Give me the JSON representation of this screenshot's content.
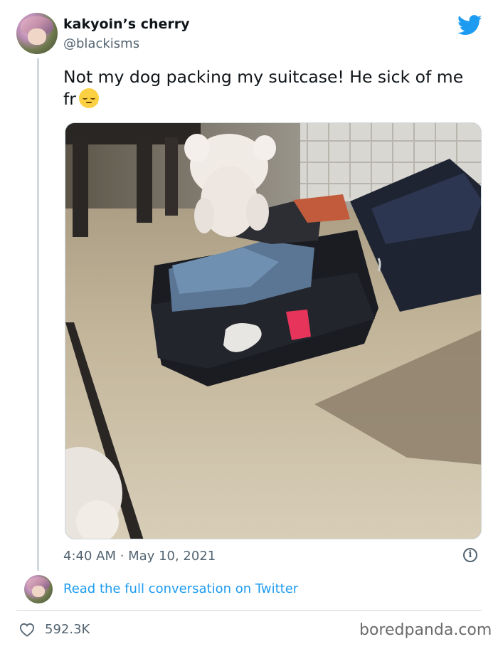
{
  "tweet": {
    "display_name": "kakyoin’s cherry",
    "handle": "@blackisms",
    "text": "Not my dog packing my suitcase! He sick of me fr",
    "emoji": "pensive-face-emoji",
    "timestamp": "4:40 AM · May 10, 2021",
    "likes": "592.3K"
  },
  "footer": {
    "read_link": "Read the full conversation on Twitter",
    "watermark": "boredpanda.com"
  },
  "icons": {
    "platform": "twitter-bird-icon",
    "info": "info-icon",
    "like": "heart-icon"
  },
  "colors": {
    "twitter_blue": "#1d9bf0",
    "secondary_text": "#536471",
    "thread_line": "#cfd9de"
  }
}
